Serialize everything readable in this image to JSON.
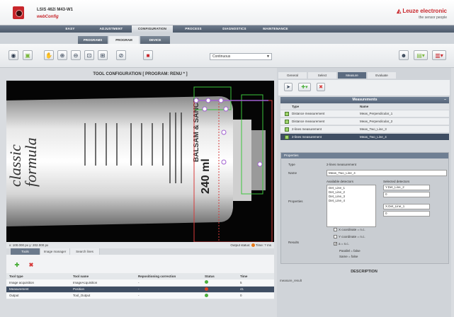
{
  "header": {
    "device_name": "LSIS 462i M43-W1",
    "product": "webConfig",
    "brand": "Leuze electronic",
    "tagline": "the sensor people"
  },
  "main_tabs": [
    "EASY",
    "ADJUSTMENT",
    "CONFIGURATION",
    "PROCESS",
    "DIAGNOSTICS",
    "MAINTENANCE"
  ],
  "active_main_tab": "CONFIGURATION",
  "sub_tabs": [
    "PROGRAMS",
    "PROGRAM",
    "DEVICE"
  ],
  "active_sub_tab": "PROGRAM",
  "toolbar": {
    "trigger_mode": "Continuous"
  },
  "left_pane": {
    "title": "TOOL CONFIGURATION  [ PROGRAM: RENU * ]",
    "coords": "x: 100.000 px  y: 202.000 px",
    "output_status_label": "Output status:",
    "time_label": "Time:",
    "time_value": "? ms",
    "bottom_tabs": [
      "Tools",
      "Image manager",
      "Search lines"
    ],
    "active_bottom_tab": "Tools",
    "table": {
      "headers": [
        "Tool type",
        "Tool name",
        "Repositioning correction",
        "Status",
        "Time"
      ],
      "rows": [
        {
          "type": "Image acquisition",
          "name": "ImageAcquisition",
          "corr": "-",
          "status_color": "#4caf3c",
          "time": "5"
        },
        {
          "type": "Measurement",
          "name": "Position",
          "corr": "-",
          "status_color": "#e04020",
          "time": "41"
        },
        {
          "type": "Output",
          "name": "Tool_Output",
          "corr": "-",
          "status_color": "#4caf3c",
          "time": "0"
        }
      ],
      "selected_row": 1
    }
  },
  "image_text": {
    "brand_1": "classic",
    "brand_2": "formula",
    "volume": "240 ml",
    "side_text": "BALSAM & SANCE"
  },
  "right_panel": {
    "tabs": [
      "General",
      "Select",
      "Measure",
      "Evaluate"
    ],
    "active_tab": "Measure",
    "measurements_title": "Measurements",
    "col_type": "Type",
    "col_name": "Name",
    "measurements": [
      {
        "type": "Distance measurement",
        "name": "Meas_Perpendicular_1"
      },
      {
        "type": "Distance measurement",
        "name": "Meas_Perpendicular_2"
      },
      {
        "type": "2-lines measurement",
        "name": "Meas_Two_Line_3"
      },
      {
        "type": "2-lines measurement",
        "name": "Meas_Two_Line_4"
      }
    ],
    "selected_measurement": 3,
    "properties": {
      "header": "Properties",
      "type_label": "Type",
      "type_value": "2-lines measurement",
      "name_label": "Name",
      "name_value": "Meas_Two_Line_4",
      "props_label": "Properties",
      "available_label": "Available detectors",
      "selected_label": "Selected detectors",
      "available": [
        "Det_Line_1",
        "Det_Line_2",
        "Det_Line_3",
        "Det_Line_4"
      ],
      "selected_1": "Y.Det_Line_2",
      "selected_1_value": "0",
      "selected_2": "X.Det_Line_1",
      "selected_2_value": "0",
      "results_label": "Results",
      "result_x": "X coordinate = n.c.",
      "result_y": "Y coordinate = n.c.",
      "result_a": "a = n.c.",
      "parallel": "Parallel = false",
      "same": "Same = false"
    },
    "description_title": "DESCRIPTION",
    "description_text": "measure_result"
  }
}
